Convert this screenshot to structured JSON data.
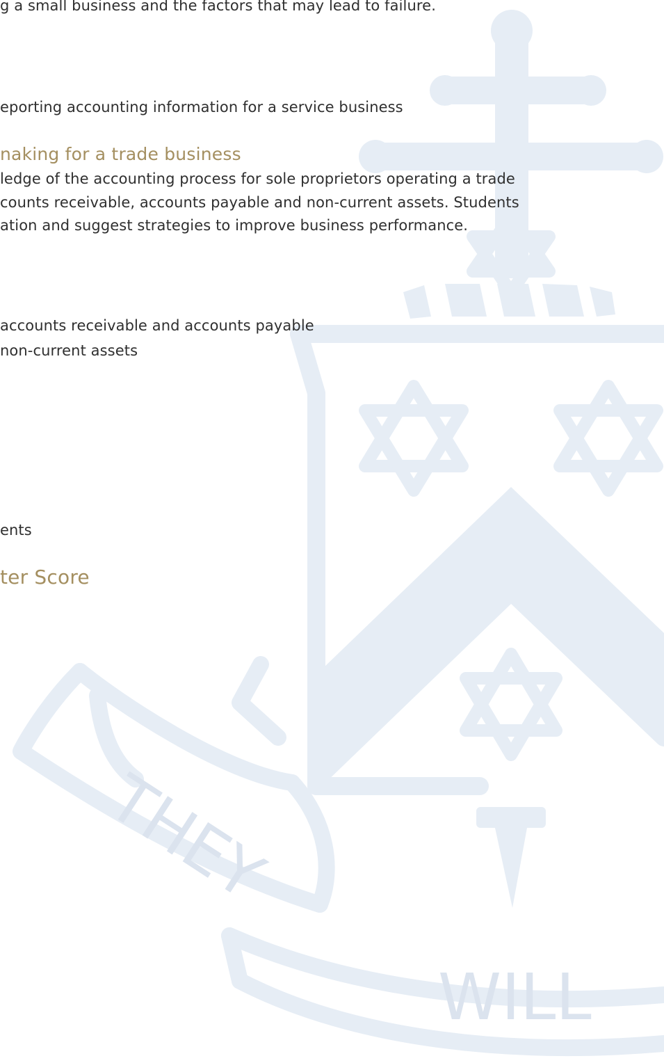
{
  "crest": {
    "motto_left": "THEY",
    "motto_right": "WILL",
    "colors": {
      "watermark": "#e6edf5",
      "watermark_text": "#dbe3ee"
    }
  },
  "colors": {
    "heading": "#a48f60",
    "body_text": "#2f2f2f"
  },
  "text": {
    "line_1": "g a small business and the factors that may lead to failure.",
    "line_2": "eporting accounting information for a service business",
    "heading_1": "naking for a trade business",
    "para_1": "ledge of the accounting process for sole proprietors operating a trade",
    "para_2": "counts receivable, accounts payable and non-current assets. Students",
    "para_3": "ation and suggest strategies to improve business performance.",
    "bullet_1": "accounts receivable and accounts payable",
    "bullet_2": "non-current assets",
    "line_ents": "ents",
    "heading_2": "ter Score"
  }
}
